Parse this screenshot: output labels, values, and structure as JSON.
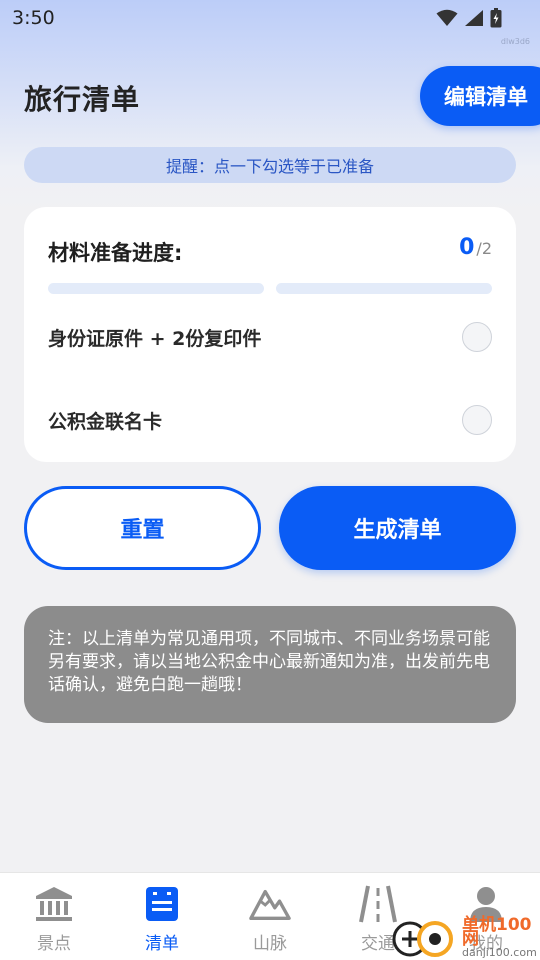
{
  "status_bar": {
    "time": "3:50"
  },
  "watermark_top": "dlw3d6",
  "header": {
    "title": "旅行清单",
    "edit_label": "编辑清单"
  },
  "reminder": "提醒：点一下勾选等于已准备",
  "progress": {
    "label": "材料准备进度:",
    "done": "0",
    "separator": "/",
    "total": "2",
    "fraction": 0.0
  },
  "checklist": [
    {
      "label": "身份证原件 + 2份复印件",
      "checked": false
    },
    {
      "label": "公积金联名卡",
      "checked": false
    }
  ],
  "actions": {
    "reset_label": "重置",
    "generate_label": "生成清单"
  },
  "note": "注：以上清单为常见通用项，不同城市、不同业务场景可能另有要求，请以当地公积金中心最新通知为准，出发前先电话确认，避免白跑一趟哦！",
  "tabs": [
    {
      "label": "景点",
      "icon": "landmark-icon",
      "active": false
    },
    {
      "label": "清单",
      "icon": "list-icon",
      "active": true
    },
    {
      "label": "山脉",
      "icon": "mountain-icon",
      "active": false
    },
    {
      "label": "交通",
      "icon": "road-icon",
      "active": false
    },
    {
      "label": "我的",
      "icon": "user-icon",
      "active": false
    }
  ],
  "watermark_bottom": {
    "main": "单机100网",
    "sub": "danji100.com"
  },
  "colors": {
    "accent": "#0a5cf5",
    "note_bg": "#8c8c8c",
    "reminder_bg": "#cdd9f4"
  }
}
